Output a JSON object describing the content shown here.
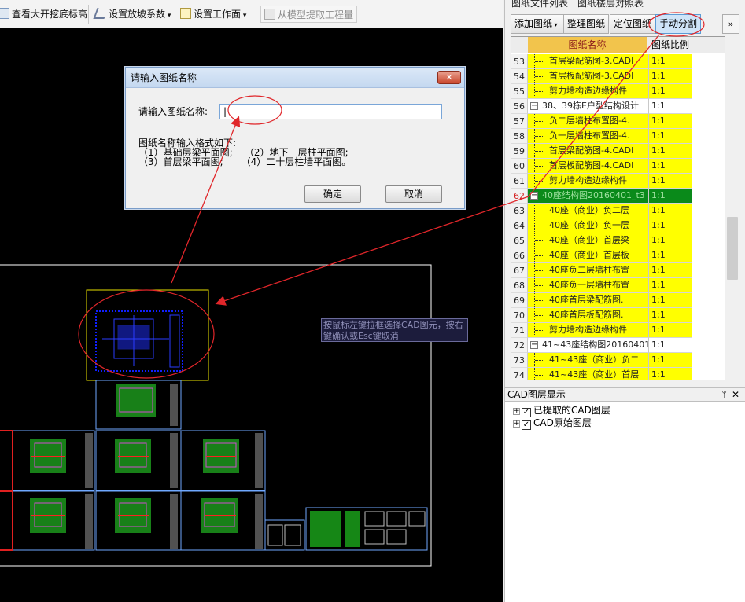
{
  "toolbar": {
    "items": [
      {
        "label": "查看大开挖底标高",
        "icon": "excavation-icon"
      },
      {
        "label": "设置放坡系数",
        "icon": "slope-icon"
      },
      {
        "label": "设置工作面",
        "icon": "workface-icon"
      },
      {
        "label": "从模型提取工程量",
        "icon": "extract-icon"
      }
    ]
  },
  "dialog": {
    "title": "请输入图纸名称",
    "close_symbol": "✕",
    "input_label": "请输入图纸名称:",
    "input_value": "|",
    "format_line1": "图纸名称输入格式如下:",
    "format_line2": "（1）基础层梁平面图;    （2）地下一层柱平面图;",
    "format_line3": "（3）首层梁平面图;      （4）二十层柱墙平面图。",
    "ok_label": "确定",
    "cancel_label": "取消"
  },
  "canvas": {
    "tooltip": "按鼠标左键拉框选择CAD图元，按右键确认或Esc键取消"
  },
  "right_panel": {
    "tabs": [
      "图纸文件列表",
      "图纸楼层对照表"
    ],
    "buttons": [
      "添加图纸",
      "整理图纸",
      "定位图纸",
      "手动分割"
    ],
    "more_symbol": "»",
    "col_name": "图纸名称",
    "col_scale": "图纸比例",
    "rows": [
      {
        "num": "53",
        "name": "首层梁配筋图-3.CADI",
        "scale": "1:1",
        "style": "yellow",
        "level": 2
      },
      {
        "num": "54",
        "name": "首层板配筋图-3.CADI",
        "scale": "1:1",
        "style": "yellow",
        "level": 2
      },
      {
        "num": "55",
        "name": "剪力墙构造边缘构件",
        "scale": "1:1",
        "style": "yellow",
        "level": 2
      },
      {
        "num": "56",
        "name": "38、39栋E户型结构设计",
        "scale": "1:1",
        "style": "white",
        "level": 1
      },
      {
        "num": "57",
        "name": "负二层墙柱布置图-4.",
        "scale": "1:1",
        "style": "yellow",
        "level": 2
      },
      {
        "num": "58",
        "name": "负一层墙柱布置图-4.",
        "scale": "1:1",
        "style": "yellow",
        "level": 2
      },
      {
        "num": "59",
        "name": "首层梁配筋图-4.CADI",
        "scale": "1:1",
        "style": "yellow",
        "level": 2
      },
      {
        "num": "60",
        "name": "首层板配筋图-4.CADI",
        "scale": "1:1",
        "style": "yellow",
        "level": 2
      },
      {
        "num": "61",
        "name": "剪力墙构造边缘构件",
        "scale": "1:1",
        "style": "yellow",
        "level": 2
      },
      {
        "num": "62",
        "name": "40座结构图20160401_t3",
        "scale": "1:1",
        "style": "green",
        "level": 1
      },
      {
        "num": "63",
        "name": "40座（商业）负二层",
        "scale": "1:1",
        "style": "yellow",
        "level": 2
      },
      {
        "num": "64",
        "name": "40座（商业）负一层",
        "scale": "1:1",
        "style": "yellow",
        "level": 2
      },
      {
        "num": "65",
        "name": "40座（商业）首层梁",
        "scale": "1:1",
        "style": "yellow",
        "level": 2
      },
      {
        "num": "66",
        "name": "40座（商业）首层板",
        "scale": "1:1",
        "style": "yellow",
        "level": 2
      },
      {
        "num": "67",
        "name": "40座负二层墙柱布置",
        "scale": "1:1",
        "style": "yellow",
        "level": 2
      },
      {
        "num": "68",
        "name": "40座负一层墙柱布置",
        "scale": "1:1",
        "style": "yellow",
        "level": 2
      },
      {
        "num": "69",
        "name": "40座首层梁配筋图.",
        "scale": "1:1",
        "style": "yellow",
        "level": 2
      },
      {
        "num": "70",
        "name": "40座首层板配筋图.",
        "scale": "1:1",
        "style": "yellow",
        "level": 2
      },
      {
        "num": "71",
        "name": "剪力墙构造边缘构件",
        "scale": "1:1",
        "style": "yellow",
        "level": 2
      },
      {
        "num": "72",
        "name": "41~43座结构图20160401",
        "scale": "1:1",
        "style": "white",
        "level": 1
      },
      {
        "num": "73",
        "name": "41~43座（商业）负二",
        "scale": "1:1",
        "style": "yellow",
        "level": 2
      },
      {
        "num": "74",
        "name": "41~43座（商业）首层",
        "scale": "1:1",
        "style": "yellow",
        "level": 2
      }
    ],
    "layer_title": "CAD图层显示",
    "pin_symbol": "ᛘ",
    "close_symbol": "✕",
    "layers": [
      {
        "label": "已提取的CAD图层",
        "checked": true
      },
      {
        "label": "CAD原始图层",
        "checked": true
      }
    ]
  },
  "colors": {
    "annotation": "#e0262a",
    "selection_box": "#e8e000",
    "drawing_frame": "#6fa8ff",
    "sheet_border": "#ffffff",
    "row_highlight": "#ffff00",
    "row_selected": "#0a8a1a"
  }
}
